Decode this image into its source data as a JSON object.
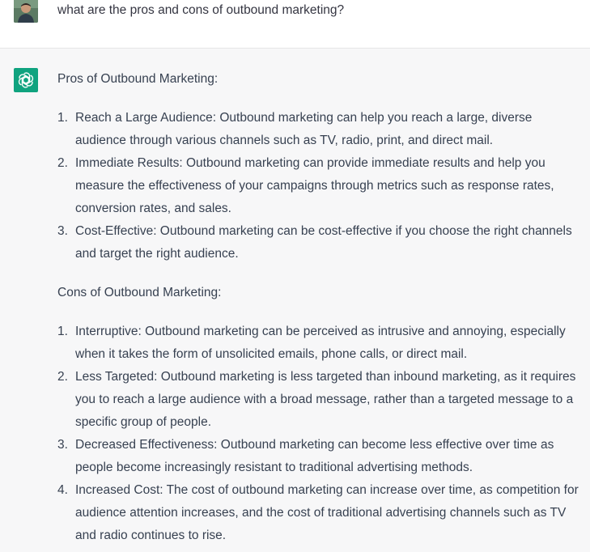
{
  "user": {
    "avatar_icon": "user-avatar-photo",
    "message": "what are the pros and cons of outbound marketing?"
  },
  "assistant": {
    "logo_icon": "openai-logo-icon",
    "logo_color": "#10a37f",
    "pros_heading": "Pros of Outbound Marketing:",
    "pros": [
      {
        "num": "1.",
        "text": "Reach a Large Audience: Outbound marketing can help you reach a large, diverse audience through various channels such as TV, radio, print, and direct mail."
      },
      {
        "num": "2.",
        "text": "Immediate Results: Outbound marketing can provide immediate results and help you measure the effectiveness of your campaigns through metrics such as response rates, conversion rates, and sales."
      },
      {
        "num": "3.",
        "text": "Cost-Effective: Outbound marketing can be cost-effective if you choose the right channels and target the right audience."
      }
    ],
    "cons_heading": "Cons of Outbound Marketing:",
    "cons": [
      {
        "num": "1.",
        "text": "Interruptive: Outbound marketing can be perceived as intrusive and annoying, especially when it takes the form of unsolicited emails, phone calls, or direct mail."
      },
      {
        "num": "2.",
        "text": "Less Targeted: Outbound marketing is less targeted than inbound marketing, as it requires you to reach a large audience with a broad message, rather than a targeted message to a specific group of people."
      },
      {
        "num": "3.",
        "text": "Decreased Effectiveness: Outbound marketing can become less effective over time as people become increasingly resistant to traditional advertising methods."
      },
      {
        "num": "4.",
        "text": "Increased Cost: The cost of outbound marketing can increase over time, as competition for audience attention increases, and the cost of traditional advertising channels such as TV and radio continues to rise."
      }
    ]
  }
}
